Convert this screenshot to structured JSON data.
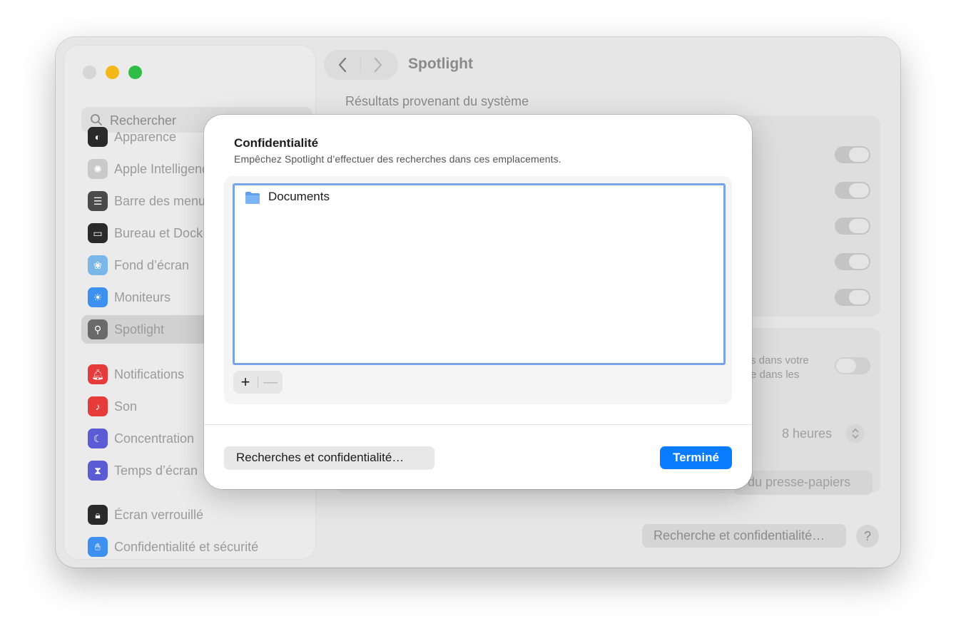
{
  "window": {
    "title": "Spotlight",
    "colors": {
      "close": "#d6d6d6",
      "minimize": "#f4b81b",
      "maximize": "#2fbd48"
    }
  },
  "sidebar": {
    "search_placeholder": "Rechercher",
    "items": [
      {
        "label": "Apparence",
        "icon": "appearance-icon",
        "color": "#2a2a2a"
      },
      {
        "label": "Apple Intelligence",
        "icon": "apple-intelligence-icon",
        "color": "#c9c9c9"
      },
      {
        "label": "Barre des menus",
        "icon": "menu-bar-icon",
        "color": "#4a4a4a"
      },
      {
        "label": "Bureau et Dock",
        "icon": "desktop-dock-icon",
        "color": "#2a2a2a"
      },
      {
        "label": "Fond d’écran",
        "icon": "wallpaper-icon",
        "color": "#7ab6e8"
      },
      {
        "label": "Moniteurs",
        "icon": "displays-icon",
        "color": "#3d8ff0"
      },
      {
        "label": "Spotlight",
        "icon": "spotlight-icon",
        "color": "#6a6a6a",
        "selected": true
      },
      {
        "label": "Notifications",
        "icon": "notifications-icon",
        "color": "#e53b3b"
      },
      {
        "label": "Son",
        "icon": "sound-icon",
        "color": "#e53b3b"
      },
      {
        "label": "Concentration",
        "icon": "focus-icon",
        "color": "#5b5bd6"
      },
      {
        "label": "Temps d’écran",
        "icon": "screen-time-icon",
        "color": "#5b5bd6"
      },
      {
        "label": "Écran verrouillé",
        "icon": "lock-screen-icon",
        "color": "#2a2a2a"
      },
      {
        "label": "Confidentialité et sécurité",
        "icon": "privacy-hand-icon",
        "color": "#3d8ff0"
      }
    ]
  },
  "main": {
    "section_label": "Résultats provenant du système",
    "fragment_1": "s dans votre",
    "fragment_2": "e dans les",
    "hours_value": "8 heures",
    "clipboard_button": "du presse-papiers",
    "bottom_button": "Recherche et confidentialité…",
    "help_label": "?"
  },
  "sheet": {
    "title": "Confidentialité",
    "subtitle": "Empêchez Spotlight d’effectuer des recherches dans ces emplacements.",
    "items": [
      {
        "name": "Documents",
        "icon": "folder-icon"
      }
    ],
    "add_label": "+",
    "remove_label": "—",
    "secondary_button": "Recherches et confidentialité…",
    "primary_button": "Terminé",
    "accent_color": "#0a7cff",
    "focus_ring_color": "#7ba4e8"
  }
}
